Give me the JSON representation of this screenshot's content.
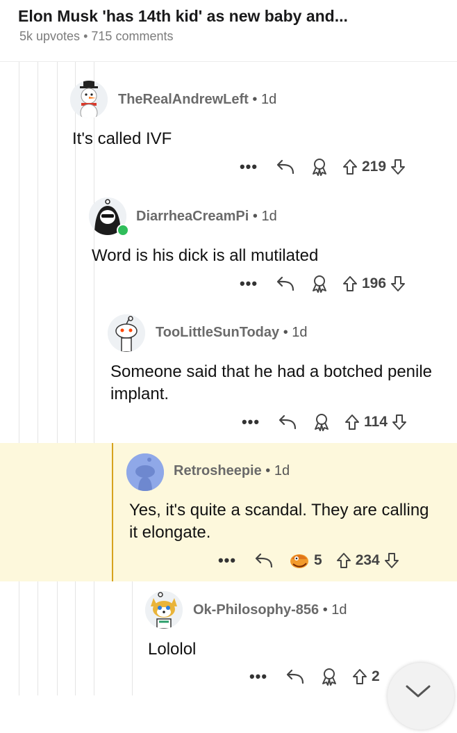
{
  "post": {
    "title": "Elon Musk 'has 14th kid' as new baby and...",
    "upvotes": "5k upvotes",
    "separator": "•",
    "comments": "715 comments"
  },
  "comments": [
    {
      "author": "TheRealAndrewLeft",
      "age": "1d",
      "text": "It's called IVF",
      "score": "219",
      "avatar": "snowman-avatar"
    },
    {
      "author": "DiarrheaCreamPi",
      "age": "1d",
      "text": "Word is his dick is all mutilated",
      "score": "196",
      "avatar": "hooded-sunglasses-avatar"
    },
    {
      "author": "TooLittleSunToday",
      "age": "1d",
      "text": "Someone said that he had a botched penile implant.",
      "score": "114",
      "avatar": "snoo-avatar"
    },
    {
      "author": "Retrosheepie",
      "age": "1d",
      "text": "Yes, it's quite a scandal. They are calling it elongate.",
      "score": "234",
      "award_count": "5",
      "avatar": "default-blue-avatar"
    },
    {
      "author": "Ok-Philosophy-856",
      "age": "1d",
      "text": "Lololol",
      "score": "2",
      "avatar": "shiba-avatar"
    }
  ],
  "icons": {
    "more": "more-dots-icon",
    "reply": "reply-arrow-icon",
    "award": "award-icon",
    "upvote": "upvote-icon",
    "downvote": "downvote-icon"
  },
  "colors": {
    "highlight_bg": "#fdf8dc",
    "highlight_bar": "#d6a21f",
    "online_dot": "#2fbd5a"
  }
}
